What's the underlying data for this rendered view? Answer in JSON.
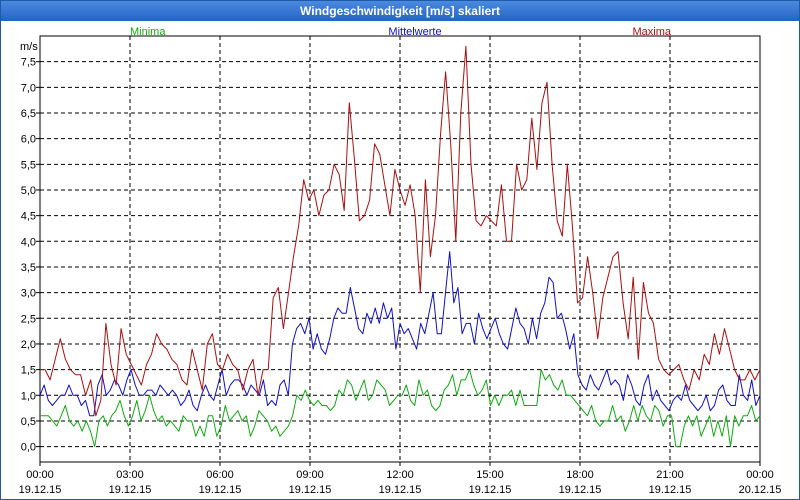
{
  "window": {
    "title": "Windgeschwindigkeit [m/s] skaliert"
  },
  "chart_data": {
    "type": "line",
    "title": "Windgeschwindigkeit [m/s] skaliert",
    "ylabel": "m/s",
    "ylim": [
      -0.3,
      8.0
    ],
    "xlim": [
      0,
      24
    ],
    "grid": true,
    "legend_position": "top",
    "y_ticks": [
      "0,0",
      "0,5",
      "1,0",
      "1,5",
      "2,0",
      "2,5",
      "3,0",
      "3,5",
      "4,0",
      "4,5",
      "5,0",
      "5,5",
      "6,0",
      "6,5",
      "7,0",
      "7,5"
    ],
    "x_ticks": [
      {
        "time": "00:00",
        "date": "19.12.15"
      },
      {
        "time": "03:00",
        "date": "19.12.15"
      },
      {
        "time": "06:00",
        "date": "19.12.15"
      },
      {
        "time": "09:00",
        "date": "19.12.15"
      },
      {
        "time": "12:00",
        "date": "19.12.15"
      },
      {
        "time": "15:00",
        "date": "19.12.15"
      },
      {
        "time": "18:00",
        "date": "19.12.15"
      },
      {
        "time": "21:00",
        "date": "19.12.15"
      },
      {
        "time": "00:00",
        "date": "20.12.15"
      }
    ],
    "series": [
      {
        "name": "Minima",
        "color": "#11aa11",
        "legend_align": "left",
        "values": [
          0.6,
          0.6,
          0.6,
          0.5,
          0.4,
          0.6,
          0.8,
          0.5,
          0.4,
          0.5,
          0.3,
          0.5,
          0.3,
          0.0,
          0.5,
          0.6,
          0.4,
          0.6,
          0.7,
          0.9,
          0.6,
          0.4,
          0.6,
          0.9,
          0.5,
          0.7,
          1.0,
          0.7,
          0.5,
          0.6,
          0.4,
          0.5,
          0.4,
          0.3,
          0.6,
          0.5,
          0.5,
          0.2,
          0.4,
          0.2,
          0.6,
          0.6,
          0.2,
          0.4,
          0.8,
          0.5,
          0.6,
          0.7,
          0.5,
          0.6,
          0.2,
          0.4,
          0.7,
          0.6,
          0.5,
          0.3,
          0.4,
          0.2,
          0.3,
          0.4,
          0.6,
          1.0,
          0.9,
          1.1,
          0.9,
          0.8,
          0.9,
          0.8,
          0.8,
          0.7,
          0.8,
          1.1,
          1.0,
          1.3,
          1.2,
          0.9,
          1.1,
          1.3,
          0.9,
          1.0,
          1.3,
          1.2,
          1.1,
          0.8,
          0.9,
          1.0,
          1.0,
          1.2,
          0.9,
          0.8,
          1.3,
          1.0,
          1.1,
          0.8,
          0.7,
          0.8,
          1.1,
          1.2,
          1.4,
          1.0,
          1.3,
          1.3,
          1.5,
          1.2,
          1.0,
          1.1,
          1.3,
          0.8,
          1.0,
          0.8,
          1.0,
          1.0,
          1.1,
          0.8,
          1.1,
          0.8,
          0.8,
          0.8,
          0.8,
          1.5,
          1.3,
          1.4,
          1.2,
          1.1,
          1.3,
          1.0,
          1.0,
          0.9,
          0.8,
          0.7,
          0.6,
          0.8,
          0.5,
          0.4,
          0.5,
          0.5,
          0.8,
          0.5,
          0.6,
          0.3,
          0.5,
          0.8,
          0.5,
          0.8,
          0.6,
          0.5,
          0.8,
          0.7,
          0.4,
          0.6,
          0.6,
          0.0,
          0.0,
          0.4,
          0.6,
          0.4,
          0.6,
          0.2,
          0.4,
          0.6,
          0.2,
          0.5,
          0.2,
          0.6,
          0.0,
          0.6,
          0.4,
          0.6,
          0.6,
          0.8,
          0.5,
          0.6
        ]
      },
      {
        "name": "Mittelwerte",
        "color": "#1010c8",
        "legend_align": "center",
        "values": [
          1.0,
          1.2,
          0.9,
          0.8,
          0.9,
          1.0,
          1.0,
          1.2,
          1.0,
          1.0,
          0.8,
          0.9,
          0.6,
          0.6,
          1.2,
          1.4,
          1.0,
          1.1,
          1.3,
          1.2,
          1.0,
          1.3,
          1.5,
          1.2,
          1.0,
          1.0,
          1.1,
          1.1,
          1.0,
          1.2,
          1.1,
          1.0,
          1.1,
          1.0,
          0.8,
          0.9,
          1.1,
          0.8,
          0.7,
          1.0,
          1.2,
          1.0,
          0.9,
          1.2,
          1.5,
          1.0,
          1.2,
          1.3,
          1.3,
          1.2,
          1.0,
          1.2,
          1.1,
          1.0,
          1.3,
          0.8,
          0.9,
          0.8,
          1.2,
          1.3,
          1.0,
          2.0,
          2.3,
          2.4,
          2.2,
          2.5,
          1.9,
          2.2,
          1.9,
          1.8,
          2.1,
          2.5,
          2.7,
          2.6,
          2.6,
          3.1,
          2.7,
          2.3,
          2.2,
          2.6,
          2.4,
          2.7,
          2.4,
          2.8,
          2.5,
          2.7,
          1.9,
          2.4,
          2.2,
          2.3,
          2.1,
          1.9,
          2.4,
          2.2,
          2.6,
          3.0,
          2.2,
          2.2,
          3.0,
          3.8,
          2.8,
          3.1,
          2.2,
          2.4,
          2.4,
          2.0,
          2.6,
          2.3,
          2.1,
          2.3,
          2.5,
          2.2,
          2.0,
          1.9,
          2.3,
          2.7,
          2.4,
          2.3,
          2.0,
          2.5,
          2.1,
          2.6,
          2.8,
          3.3,
          3.2,
          2.5,
          2.6,
          2.3,
          1.9,
          2.2,
          1.4,
          1.2,
          1.1,
          1.4,
          1.2,
          1.1,
          1.3,
          1.5,
          1.2,
          1.3,
          1.2,
          0.9,
          1.4,
          1.2,
          0.9,
          0.8,
          1.2,
          1.4,
          0.9,
          1.1,
          0.9,
          0.8,
          0.7,
          0.9,
          1.0,
          0.9,
          1.2,
          0.9,
          0.8,
          0.7,
          0.8,
          1.0,
          0.7,
          0.8,
          1.1,
          1.2,
          0.9,
          0.8,
          0.8,
          1.4,
          1.0,
          0.9,
          1.3,
          0.8,
          1.0
        ]
      },
      {
        "name": "Maxima",
        "color": "#aa1010",
        "legend_align": "right",
        "values": [
          1.5,
          1.5,
          1.3,
          1.7,
          2.1,
          1.7,
          1.5,
          1.4,
          1.4,
          1.0,
          1.3,
          0.6,
          0.9,
          2.4,
          1.6,
          1.2,
          2.3,
          1.8,
          1.6,
          1.4,
          1.2,
          1.6,
          1.8,
          2.2,
          2.0,
          1.9,
          1.7,
          1.6,
          1.3,
          1.2,
          1.9,
          1.5,
          1.1,
          2.0,
          2.2,
          1.6,
          1.5,
          1.8,
          1.6,
          1.5,
          1.1,
          1.5,
          1.7,
          1.0,
          1.5,
          1.5,
          2.9,
          3.1,
          2.3,
          3.0,
          3.7,
          4.3,
          5.2,
          4.8,
          5.0,
          4.5,
          4.9,
          5.0,
          5.5,
          5.3,
          4.6,
          6.7,
          5.6,
          4.4,
          4.5,
          4.8,
          5.9,
          5.7,
          5.1,
          4.5,
          5.4,
          5.0,
          4.7,
          5.1,
          4.5,
          3.0,
          5.2,
          3.7,
          4.5,
          6.1,
          7.3,
          5.9,
          4.0,
          6.5,
          7.8,
          5.5,
          4.4,
          4.3,
          4.5,
          4.4,
          4.3,
          5.1,
          4.0,
          4.0,
          5.5,
          5.0,
          5.2,
          6.4,
          5.4,
          6.7,
          7.1,
          5.5,
          4.4,
          4.1,
          5.5,
          4.3,
          2.8,
          2.9,
          3.7,
          3.0,
          2.1,
          2.9,
          3.3,
          3.7,
          3.8,
          2.8,
          2.1,
          3.3,
          1.7,
          3.2,
          2.6,
          2.4,
          1.7,
          1.5,
          1.4,
          1.5,
          1.6,
          1.3,
          1.1,
          1.5,
          1.3,
          1.8,
          1.6,
          2.2,
          1.8,
          2.3,
          1.9,
          1.5,
          1.3,
          1.3,
          1.5,
          1.3,
          1.5
        ]
      }
    ]
  }
}
